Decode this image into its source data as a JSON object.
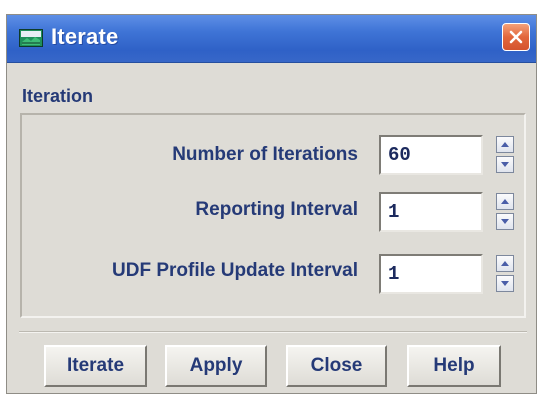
{
  "window": {
    "title": "Iterate",
    "icon": "fluent-app-icon",
    "close_icon": "close-icon"
  },
  "group": {
    "label": "Iteration"
  },
  "fields": [
    {
      "label": "Number of Iterations",
      "value": "60"
    },
    {
      "label": "Reporting Interval",
      "value": "1"
    },
    {
      "label": "UDF Profile Update Interval",
      "value": "1"
    }
  ],
  "buttons": {
    "iterate": "Iterate",
    "apply": "Apply",
    "close": "Close",
    "help": "Help"
  },
  "colors": {
    "titlebar": "#3f74d6",
    "dialog_bg": "#dedcd6",
    "label_text": "#253a77",
    "close_button": "#e2673c"
  }
}
